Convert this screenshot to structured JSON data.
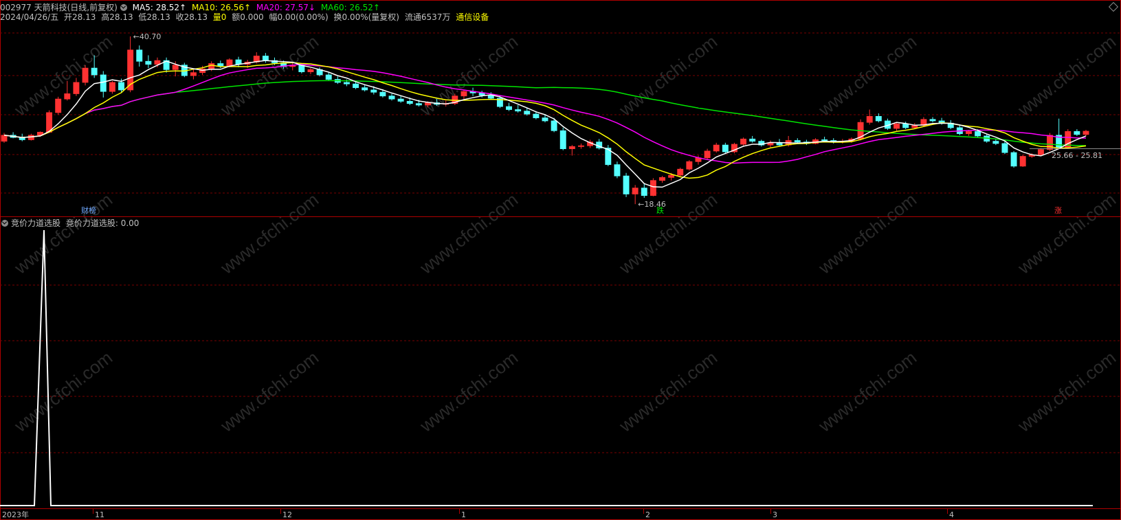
{
  "header": {
    "code_name": "002977 天箭科技(日线,前复权)",
    "ma5": "MA5: 28.52↑",
    "ma10": "MA10: 26.56↑",
    "ma20": "MA20: 27.57↓",
    "ma60": "MA60: 26.52↑",
    "date": "2024/04/26/五",
    "open": "开28.13",
    "high": "高28.13",
    "low": "低28.13",
    "close": "收28.13",
    "volume": "量0",
    "amount": "额0.000",
    "amplitude": "幅0.00(0.00%)",
    "turnover": "换0.00%(量复权)",
    "float": "流通6537万",
    "industry": "通信设备"
  },
  "indicator": {
    "name": "竞价力道选股",
    "value_label": "竞价力道选股: 0.00"
  },
  "annotations": {
    "high_mark": "40.70",
    "low_mark": "18.46",
    "range_mark": "25.66 - 25.81",
    "tag_finance": "财榜",
    "tag_fall": "跌",
    "tag_rise": "涨"
  },
  "x_axis": {
    "labels": [
      "2023年",
      "11",
      "12",
      "1",
      "2",
      "3",
      "4"
    ]
  },
  "watermark": "www.cfchi.com",
  "colors": {
    "up": "#ff3232",
    "down": "#54ffff",
    "ma5": "#ffffff",
    "ma10": "#ffff00",
    "ma20": "#ff00ff",
    "ma60": "#00e600",
    "grid": "#7a0000",
    "frame": "#b00000",
    "indicator_line": "#ffffff",
    "industry": "#ffff00"
  },
  "chart_data": [
    {
      "type": "candlestick",
      "title": "002977 天箭科技(日线,前复权)",
      "series": [
        {
          "name": "MA5",
          "value": 28.52
        },
        {
          "name": "MA10",
          "value": 26.56
        },
        {
          "name": "MA20",
          "value": 27.57
        },
        {
          "name": "MA60",
          "value": 26.52
        }
      ],
      "annotated_high": 40.7,
      "annotated_low": 18.46,
      "x_labels": [
        "2023年",
        "11",
        "12",
        "1",
        "2",
        "3",
        "4"
      ]
    },
    {
      "type": "line",
      "title": "竞价力道选股",
      "series": [
        {
          "name": "竞价力道选股",
          "current_value": 0.0,
          "spike_value": 1.0
        }
      ],
      "x_labels": [
        "2023年",
        "11",
        "12",
        "1",
        "2",
        "3",
        "4"
      ]
    }
  ]
}
